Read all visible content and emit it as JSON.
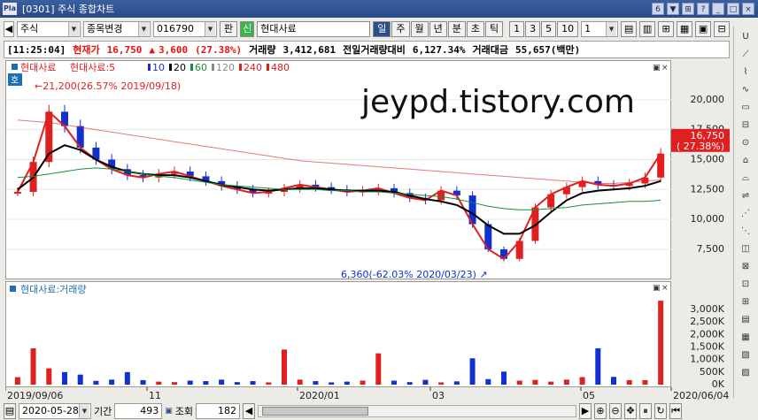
{
  "window": {
    "title": "[0301] 주식 종합차트",
    "logo": "Pla",
    "controls": [
      "6",
      "▼",
      "⊞",
      "?",
      "_",
      "□",
      "×"
    ]
  },
  "toolbar": {
    "market": "주식",
    "change_label": "종목변경",
    "code": "016790",
    "pan_label": "판",
    "sin_label": "신",
    "name": "현대사료",
    "periods": [
      "일",
      "주",
      "월",
      "년",
      "분",
      "초",
      "틱"
    ],
    "selected_period": "일",
    "intervals": [
      "1",
      "3",
      "5",
      "10"
    ],
    "interval_value": "1"
  },
  "quote": {
    "time": "[11:25:04]",
    "label": "현재가",
    "price": "16,750",
    "arrow": "▲",
    "change": "3,600",
    "change_pct": "(27.38%)",
    "volume_label": "거래량",
    "volume": "3,412,681",
    "prev_ratio_label": "전일거래량대비",
    "prev_ratio": "6,127.34%",
    "amount_label": "거래대금",
    "amount": "55,657(백만)"
  },
  "legend": {
    "name": "현대사료",
    "ma_prefix": "현대사료:5",
    "ma": [
      "10",
      "20",
      "60",
      "120",
      "240",
      "480"
    ],
    "ma_colors": [
      "#2030d0",
      "#000000",
      "#168f3a",
      "#8a8a8a",
      "#e02020",
      "#d02020"
    ],
    "ho": "호"
  },
  "annotations": {
    "high": "21,200(26.57% 2019/09/18)",
    "low": "6,360(-62.03% 2020/03/23)",
    "watermark": "jeypd.tistory.com",
    "current_tag": "16,750",
    "current_pct": "( 27.38%)"
  },
  "price_axis": {
    "ticks": [
      "20,000",
      "17,500",
      "15,000",
      "12,500",
      "10,000",
      "7,500"
    ]
  },
  "volume_pane": {
    "title": "현대사료:거래량",
    "ticks": [
      "3,000K",
      "2,500K",
      "2,000K",
      "1,500K",
      "1,000K",
      "500K",
      "0K"
    ]
  },
  "date_axis": [
    "2019/09/06",
    "11",
    "2020/01",
    "03",
    "05",
    "2020/06/04"
  ],
  "bottom": {
    "start_date": "2020-05-28",
    "period_label": "기간",
    "period": "493",
    "query_label": "조회",
    "query": "182"
  },
  "chart_data": [
    {
      "type": "line",
      "title": "현대사료",
      "y_ticks": [
        7500,
        10000,
        12500,
        15000,
        17500,
        20000
      ],
      "ylim": [
        5500,
        22500
      ],
      "series": [
        {
          "name": "현대사료:5",
          "values": [
            12300,
            14800,
            19000,
            17800,
            16000,
            15000,
            14200,
            13700,
            13500,
            13800,
            14000,
            13600,
            13200,
            12800,
            12500,
            12200,
            12300,
            12600,
            12900,
            12700,
            12500,
            12300,
            12400,
            12600,
            12200,
            11800,
            11600,
            12400,
            12000,
            9600,
            7500,
            6700,
            8200,
            11000,
            12100,
            12700,
            13200,
            12900,
            12800,
            13000,
            13500,
            15500
          ]
        },
        {
          "name": "20",
          "values": [
            12500,
            13500,
            15500,
            16200,
            15800,
            15000,
            14400,
            14000,
            13800,
            13700,
            13700,
            13500,
            13200,
            12900,
            12700,
            12500,
            12400,
            12500,
            12600,
            12600,
            12500,
            12400,
            12400,
            12400,
            12300,
            12000,
            11700,
            11500,
            11200,
            10500,
            9500,
            8800,
            8800,
            9500,
            10600,
            11600,
            12200,
            12400,
            12500,
            12600,
            12800,
            13200
          ]
        },
        {
          "name": "60",
          "values": [
            13500,
            13600,
            13800,
            14000,
            14200,
            14300,
            14200,
            14000,
            13800,
            13600,
            13500,
            13300,
            13100,
            12900,
            12800,
            12700,
            12600,
            12500,
            12500,
            12500,
            12400,
            12400,
            12300,
            12300,
            12200,
            12100,
            12000,
            11900,
            11700,
            11400,
            11100,
            10900,
            10800,
            10800,
            10900,
            11000,
            11200,
            11300,
            11400,
            11500,
            11500,
            11600
          ]
        },
        {
          "name": "240",
          "values": [
            18300,
            18200,
            18100,
            17900,
            17700,
            17500,
            17300,
            17100,
            16900,
            16700,
            16500,
            16300,
            16100,
            15900,
            15700,
            15500,
            15300,
            15100,
            14900,
            14800,
            14700,
            14600,
            14500,
            14400,
            14300,
            14200,
            14100,
            14000,
            13900,
            13800,
            13700,
            13600,
            13500,
            13400,
            13300,
            13200,
            13100,
            13000,
            13000,
            13100,
            13200,
            13300
          ]
        }
      ]
    },
    {
      "type": "bar",
      "title": "현대사료:거래량",
      "ylim": [
        0,
        3600
      ],
      "y_unit": "K",
      "values": [
        300,
        1450,
        650,
        500,
        400,
        150,
        200,
        500,
        180,
        120,
        100,
        160,
        140,
        200,
        100,
        140,
        90,
        1400,
        200,
        140,
        90,
        120,
        160,
        1250,
        160,
        100,
        190,
        90,
        130,
        1050,
        220,
        520,
        160,
        190,
        120,
        200,
        300,
        1450,
        310,
        180,
        180,
        3350
      ]
    }
  ]
}
